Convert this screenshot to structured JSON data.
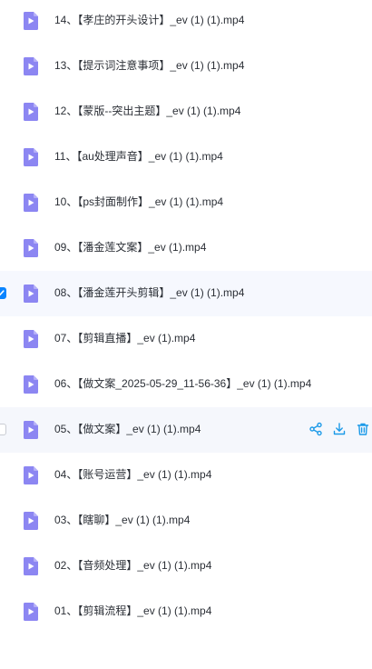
{
  "files": [
    {
      "name": "14、【孝庄的开头设计】_ev (1) (1).mp4"
    },
    {
      "name": "13、【提示词注意事项】_ev (1) (1).mp4"
    },
    {
      "name": "12、【蒙版--突出主题】_ev (1) (1).mp4"
    },
    {
      "name": "11、【au处理声音】_ev (1) (1).mp4"
    },
    {
      "name": "10、【ps封面制作】_ev (1) (1).mp4"
    },
    {
      "name": "09、【潘金莲文案】_ev (1).mp4"
    },
    {
      "name": "08、【潘金莲开头剪辑】_ev (1) (1).mp4",
      "checked": true
    },
    {
      "name": "07、【剪辑直播】_ev (1).mp4"
    },
    {
      "name": "06、【做文案_2025-05-29_11-56-36】_ev (1) (1).mp4"
    },
    {
      "name": "05、【做文案】_ev (1) (1).mp4",
      "hovered": true
    },
    {
      "name": "04、【账号运营】_ev (1) (1).mp4"
    },
    {
      "name": "03、【瞎聊】_ev (1) (1).mp4"
    },
    {
      "name": "02、【音频处理】_ev (1) (1).mp4"
    },
    {
      "name": "01、【剪辑流程】_ev (1) (1).mp4"
    }
  ],
  "colors": {
    "icon_fill": "#8c86f2",
    "icon_play": "#ffffff",
    "action_color": "#1c9ae8",
    "checked": "#0a84ff"
  },
  "icons": {
    "file": "video-file-icon",
    "share": "share-icon",
    "download": "download-icon",
    "delete": "trash-icon"
  }
}
